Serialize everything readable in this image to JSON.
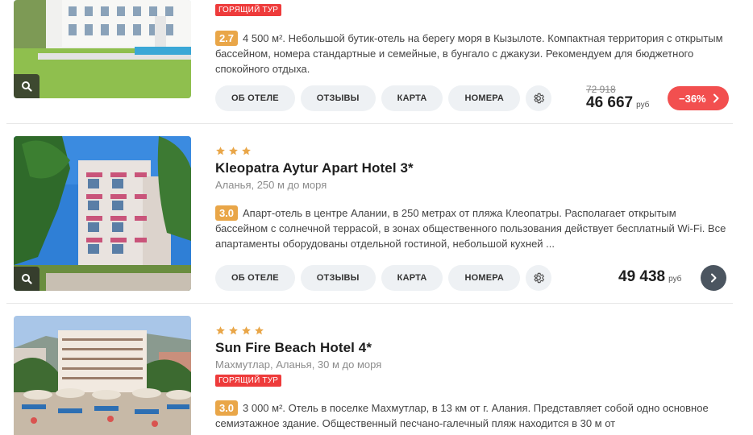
{
  "hotels": [
    {
      "hot_badge": "ГОРЯЩИЙ ТУР",
      "rating": "2.7",
      "description": "4 500 м². Небольшой бутик-отель на берегу моря в Кызылоте. Компактная территория с открытым бассейном, номера стандартные и семейные, в бунгало с джакузи. Рекомендуем для бюджетного спокойного отдыха.",
      "old_price": "72 918",
      "price": "46 667",
      "currency": "руб",
      "discount": "−36%"
    },
    {
      "stars": 3,
      "name": "Kleopatra Aytur Apart Hotel 3*",
      "location": "Аланья, 250 м до моря",
      "rating": "3.0",
      "description": "Апарт-отель в центре Алании, в 250 метрах от пляжа Клеопатры. Располагает открытым бассейном с солнечной террасой, в зонах общественного пользования действует бесплатный Wi-Fi. Все апартаменты оборудованы отдельной гостиной, небольшой кухней ...",
      "price": "49 438",
      "currency": "руб"
    },
    {
      "stars": 4,
      "name": "Sun Fire Beach Hotel 4*",
      "location": "Махмутлар, Аланья, 30 м до моря",
      "hot_badge": "ГОРЯЩИЙ ТУР",
      "rating": "3.0",
      "description": "3 000 м². Отель в поселке Махмутлар, в 13 км от г. Алания. Представляет собой одно основное семиэтажное здание. Общественный песчано-галечный пляж находится в 30 м от"
    }
  ],
  "buttons": {
    "about": "ОБ ОТЕЛЕ",
    "reviews": "ОТЗЫВЫ",
    "map": "КАРТА",
    "rooms": "НОМЕРА"
  },
  "icons": {
    "zoom": "magnifier-icon",
    "settings": "gear-icon",
    "arrow": "chevron-right-icon",
    "star": "star-icon"
  },
  "colors": {
    "star": "#e9a648",
    "rating": "#e9a648",
    "hot": "#ee3b3b",
    "discount": "#f24f4f",
    "go_button": "#4b5560",
    "pill_bg": "#eef1f4"
  }
}
